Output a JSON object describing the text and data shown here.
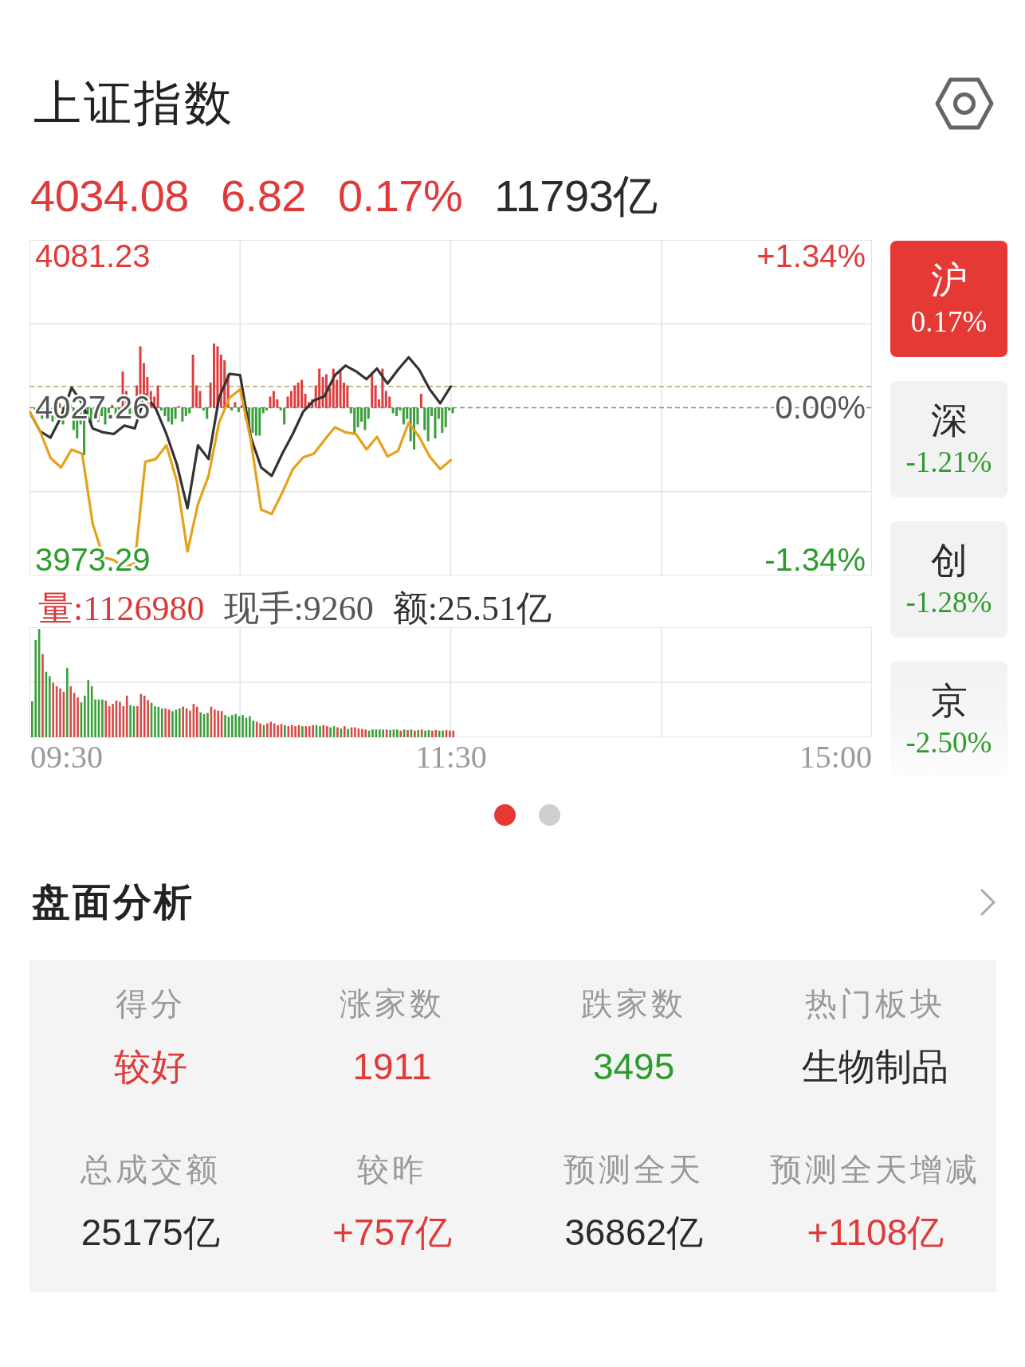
{
  "header": {
    "title": "上证指数"
  },
  "quote": [
    {
      "text": "4034.08",
      "color": "#e03a3a"
    },
    {
      "text": "6.82",
      "color": "#e03a3a"
    },
    {
      "text": "0.17%",
      "color": "#e03a3a"
    },
    {
      "text": "11793亿",
      "color": "#2b2b2b"
    }
  ],
  "intraday_chart": {
    "percent_labels": [
      {
        "text": "+1.34%",
        "color": "#e03a3a"
      },
      {
        "text": "0.00%",
        "color": "#555555"
      },
      {
        "text": "-1.34%",
        "color": "#2e9b2e"
      }
    ],
    "chart_data": {
      "type": "line",
      "categories": [
        null,
        null,
        null,
        null,
        null,
        null,
        null,
        null,
        null,
        null,
        null,
        null,
        null,
        null,
        null,
        null,
        null,
        null,
        null,
        null,
        null,
        null,
        null,
        null,
        null,
        null,
        null,
        null,
        null,
        null,
        null,
        null,
        null,
        null,
        null,
        null,
        null,
        null,
        null,
        null,
        null,
        null,
        null,
        null,
        null,
        null,
        null,
        null,
        null,
        null,
        null,
        null,
        null,
        null,
        null,
        null,
        null,
        null,
        null,
        null,
        null,
        null,
        null,
        null,
        null,
        null,
        null,
        null,
        null,
        null,
        null,
        null,
        null,
        null,
        null,
        null,
        null,
        null,
        null,
        null,
        null
      ],
      "ylim": [
        3967.6,
        4086.9
      ],
      "yticks": [
        {
          "value": 4081.23,
          "label": "4081.23"
        },
        {
          "value": 4027.26,
          "label": "4027.26"
        },
        {
          "value": 3973.29,
          "label": "3973.29"
        }
      ],
      "series": [
        {
          "color": "#333333",
          "values": [
            4025.9,
            4018.9,
            4016.6,
            4023.9,
            4034.4,
            4028.8,
            4019.9,
            4018.5,
            4017.9,
            4020.9,
            4019.9,
            4031.8,
            4026.9,
            4017.9,
            4007.0,
            3991.5,
            4013.9,
            4009.0,
            4030.8,
            4039.3,
            4038.8,
            4016.9,
            4006.0,
            4003.0,
            4010.9,
            4017.9,
            4025.9,
            4029.8,
            4031.3,
            4038.8,
            4042.2,
            4040.2,
            4037.4,
            4041.2,
            4035.8,
            4040.8,
            4045.2,
            4040.8,
            4033.8,
            4028.8,
            4034.8,
            null,
            null,
            null,
            null,
            null,
            null,
            null,
            null,
            null,
            null,
            null,
            null,
            null,
            null,
            null,
            null,
            null,
            null,
            null,
            null,
            null,
            null,
            null,
            null,
            null,
            null,
            null,
            null,
            null,
            null,
            null,
            null,
            null,
            null,
            null,
            null,
            null,
            null,
            null,
            null
          ]
        },
        {
          "color": "#e6a11c",
          "values": [
            4025.9,
            4018.9,
            4009.4,
            4006.0,
            4012.4,
            4010.9,
            3986.0,
            3974.1,
            3973.1,
            3970.2,
            3972.1,
            4008.0,
            4009.0,
            4013.9,
            4001.0,
            3976.1,
            3993.0,
            4003.0,
            4021.9,
            4030.8,
            4033.8,
            4015.9,
            3991.0,
            3989.5,
            3997.0,
            4005.4,
            4009.6,
            4010.9,
            4015.7,
            4020.3,
            4018.5,
            4017.9,
            4012.4,
            4016.9,
            4009.9,
            4011.9,
            4021.9,
            4016.9,
            4009.9,
            4005.4,
            4008.6,
            null,
            null,
            null,
            null,
            null,
            null,
            null,
            null,
            null,
            null,
            null,
            null,
            null,
            null,
            null,
            null,
            null,
            null,
            null,
            null,
            null,
            null,
            null,
            null,
            null,
            null,
            null,
            null,
            null,
            null,
            null,
            null,
            null,
            null,
            null,
            null,
            null,
            null,
            null,
            null
          ]
        }
      ]
    }
  },
  "volume": {
    "readouts": [
      {
        "text": "量:1126980",
        "color": "#d83a3a"
      },
      {
        "text": "现手:9260",
        "color": "#555555"
      },
      {
        "text": "额:25.51亿",
        "color": "#333333"
      }
    ],
    "time_axis": [
      "09:30",
      "11:30",
      "15:00"
    ]
  },
  "market_tabs": [
    {
      "name": "沪",
      "change": "0.17%",
      "selected": true
    },
    {
      "name": "深",
      "change": "-1.21%",
      "selected": false,
      "color": "#2e9b2e"
    },
    {
      "name": "创",
      "change": "-1.28%",
      "selected": false,
      "color": "#2e9b2e"
    },
    {
      "name": "京",
      "change": "-2.50%",
      "selected": false,
      "color": "#2e9b2e"
    }
  ],
  "pager_dots": [
    {
      "selected": true
    },
    {
      "selected": false
    }
  ],
  "analysis": {
    "title": "盘面分析",
    "metrics": [
      {
        "label": "得分",
        "value": "较好",
        "color": "#e03a3a"
      },
      {
        "label": "涨家数",
        "value": "1911",
        "color": "#e03a3a"
      },
      {
        "label": "跌家数",
        "value": "3495",
        "color": "#2e9b2e"
      },
      {
        "label": "热门板块",
        "value": "生物制品",
        "color": "#2b2b2b"
      },
      {
        "label": "总成交额",
        "value": "25175亿",
        "color": "#2b2b2b"
      },
      {
        "label": "较昨",
        "value": "+757亿",
        "color": "#e03a3a"
      },
      {
        "label": "预测全天",
        "value": "36862亿",
        "color": "#2b2b2b"
      },
      {
        "label": "预测全天增减",
        "value": "+1108亿",
        "color": "#e03a3a"
      }
    ]
  }
}
